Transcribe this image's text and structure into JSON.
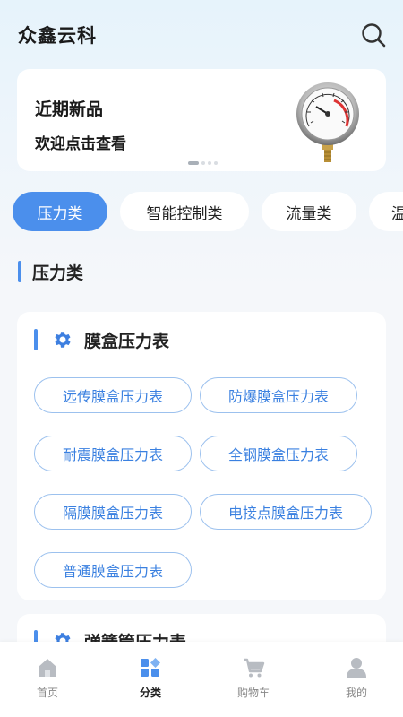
{
  "header": {
    "title": "众鑫云科",
    "search_icon": "search-icon"
  },
  "banner": {
    "title": "近期新品",
    "subtitle": "欢迎点击查看",
    "image": "pressure-gauge-image"
  },
  "tabs": [
    {
      "label": "压力类",
      "active": true
    },
    {
      "label": "智能控制类",
      "active": false
    },
    {
      "label": "流量类",
      "active": false
    },
    {
      "label": "温",
      "active": false
    }
  ],
  "section": {
    "title": "压力类"
  },
  "cards": [
    {
      "title": "膜盒压力表",
      "icon": "gear-icon",
      "items": [
        "远传膜盒压力表",
        "防爆膜盒压力表",
        "耐震膜盒压力表",
        "全钢膜盒压力表",
        "隔膜膜盒压力表",
        "电接点膜盒压力表",
        "普通膜盒压力表"
      ]
    },
    {
      "title": "弹簧管压力表",
      "icon": "gear-icon",
      "items": []
    }
  ],
  "bottom_nav": [
    {
      "label": "首页",
      "icon": "home-icon",
      "active": false
    },
    {
      "label": "分类",
      "icon": "category-icon",
      "active": true
    },
    {
      "label": "购物车",
      "icon": "cart-icon",
      "active": false
    },
    {
      "label": "我的",
      "icon": "user-icon",
      "active": false
    }
  ],
  "colors": {
    "accent": "#4b8fec",
    "pill_text": "#3a80e0",
    "pill_border": "#9cc1ee"
  }
}
